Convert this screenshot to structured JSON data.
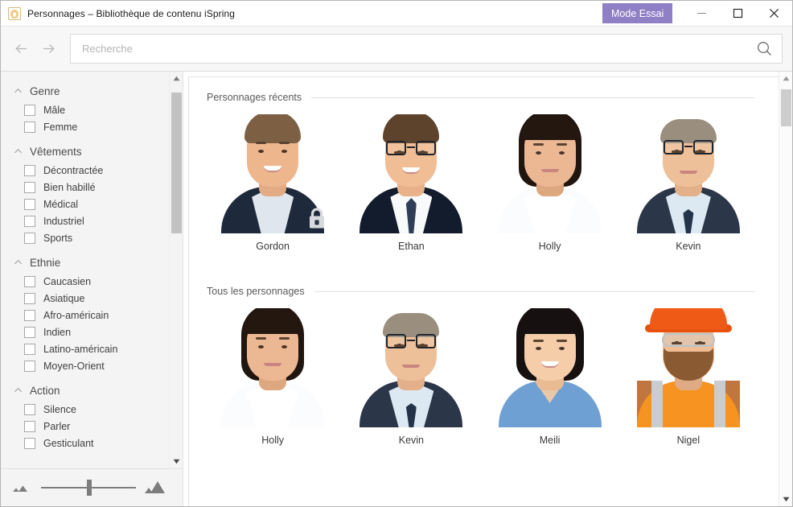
{
  "window": {
    "title": "Personnages – Bibliothèque de contenu iSpring",
    "app_icon": "person-avatar-icon",
    "trial_badge": "Mode Essai",
    "minimize_label": "Réduire",
    "maximize_label": "Agrandir",
    "close_label": "Fermer"
  },
  "toolbar": {
    "back_icon": "arrow-left-icon",
    "forward_icon": "arrow-right-icon",
    "search_placeholder": "Recherche",
    "search_value": "",
    "search_icon": "search-icon"
  },
  "sidebar": {
    "groups": [
      {
        "title": "Genre",
        "expanded": true,
        "items": [
          {
            "label": "Mâle",
            "checked": false
          },
          {
            "label": "Femme",
            "checked": false
          }
        ]
      },
      {
        "title": "Vêtements",
        "expanded": true,
        "items": [
          {
            "label": "Décontractée",
            "checked": false
          },
          {
            "label": "Bien habillé",
            "checked": false
          },
          {
            "label": "Médical",
            "checked": false
          },
          {
            "label": "Industriel",
            "checked": false
          },
          {
            "label": "Sports",
            "checked": false
          }
        ]
      },
      {
        "title": "Ethnie",
        "expanded": true,
        "items": [
          {
            "label": "Caucasien",
            "checked": false
          },
          {
            "label": "Asiatique",
            "checked": false
          },
          {
            "label": "Afro-américain",
            "checked": false
          },
          {
            "label": "Indien",
            "checked": false
          },
          {
            "label": "Latino-américain",
            "checked": false
          },
          {
            "label": "Moyen-Orient",
            "checked": false
          }
        ]
      },
      {
        "title": "Action",
        "expanded": true,
        "items": [
          {
            "label": "Silence",
            "checked": false
          },
          {
            "label": "Parler",
            "checked": false
          },
          {
            "label": "Gesticulant",
            "checked": false
          }
        ]
      }
    ]
  },
  "zoom_slider": {
    "small_icon": "small-mountains-icon",
    "large_icon": "large-mountains-icon",
    "value_percent": 48
  },
  "main": {
    "sections": [
      {
        "title": "Personnages récents",
        "characters": [
          {
            "name": "Gordon",
            "locked": true,
            "style": "gordon"
          },
          {
            "name": "Ethan",
            "locked": false,
            "style": "ethan"
          },
          {
            "name": "Holly",
            "locked": false,
            "style": "holly"
          },
          {
            "name": "Kevin",
            "locked": false,
            "style": "kevin"
          }
        ]
      },
      {
        "title": "Tous les personnages",
        "characters": [
          {
            "name": "Holly",
            "locked": false,
            "style": "holly"
          },
          {
            "name": "Kevin",
            "locked": false,
            "style": "kevin"
          },
          {
            "name": "Meili",
            "locked": false,
            "style": "meili"
          },
          {
            "name": "Nigel",
            "locked": false,
            "style": "nigel"
          }
        ]
      }
    ],
    "lock_icon": "lock-icon"
  },
  "scrollbars": {
    "sidebar": {
      "up_icon": "scroll-up-arrow-icon",
      "down_icon": "scroll-down-arrow-icon",
      "thumb_top_pct": 2,
      "thumb_height_pct": 38
    },
    "content": {
      "up_icon": "scroll-up-arrow-icon",
      "down_icon": "scroll-down-arrow-icon",
      "thumb_top_pct": 1,
      "thumb_height_pct": 9
    }
  },
  "colors": {
    "trial_badge_bg": "#8f7fc4",
    "toolbar_bg": "#f7f7f7",
    "sidebar_bg": "#f4f4f4",
    "content_bg": "#ffffff",
    "border": "#dcdcdc",
    "text": "#3a3a3a",
    "muted_text": "#5a5a5a"
  }
}
